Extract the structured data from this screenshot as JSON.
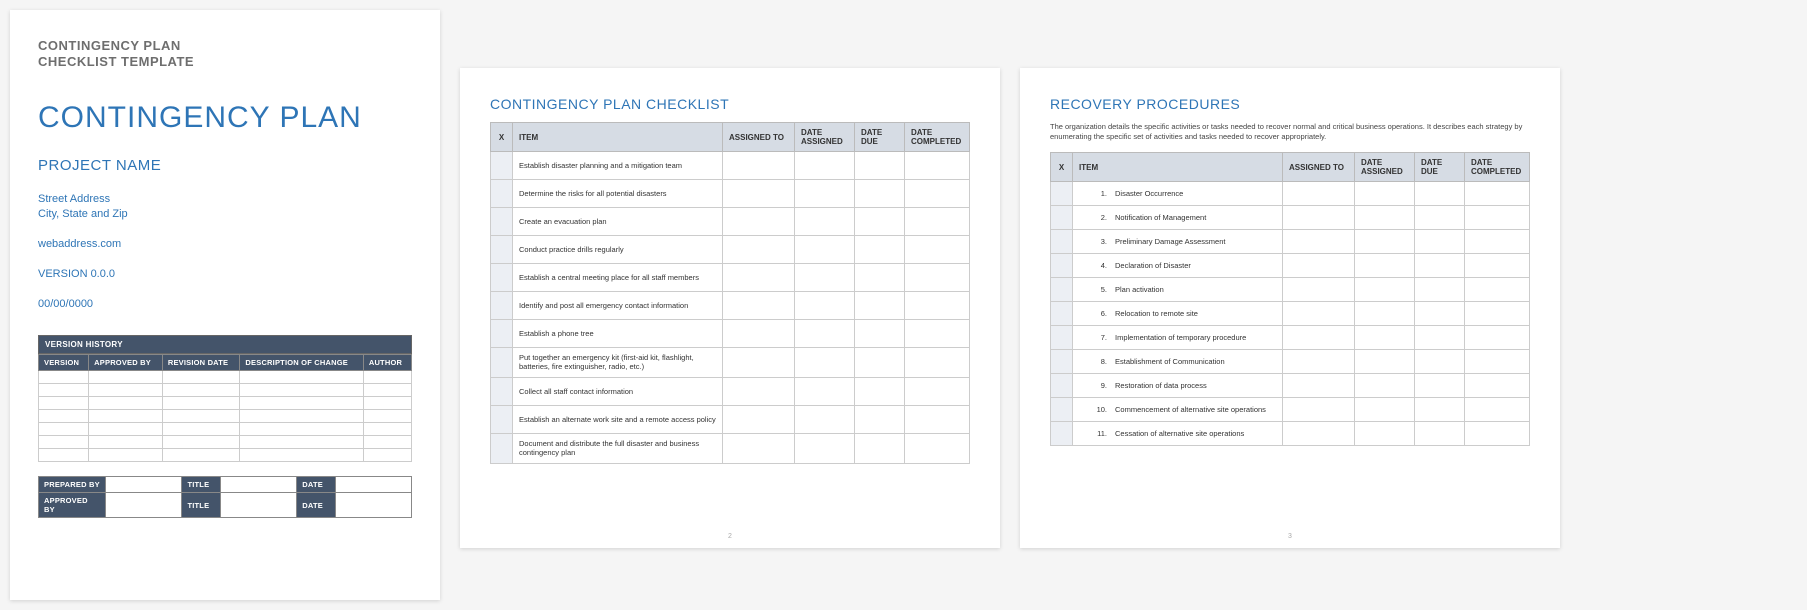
{
  "page1": {
    "label_line1": "CONTINGENCY PLAN",
    "label_line2": "CHECKLIST TEMPLATE",
    "title": "CONTINGENCY PLAN",
    "subtitle": "PROJECT NAME",
    "address_line1": "Street Address",
    "address_line2": "City, State and Zip",
    "web": "webaddress.com",
    "version": "VERSION 0.0.0",
    "date": "00/00/0000",
    "version_history": {
      "header": "VERSION HISTORY",
      "cols": [
        "VERSION",
        "APPROVED BY",
        "REVISION DATE",
        "DESCRIPTION OF CHANGE",
        "AUTHOR"
      ],
      "blank_rows": 7
    },
    "sig": {
      "rows": [
        {
          "label": "PREPARED BY",
          "title": "TITLE",
          "date": "DATE"
        },
        {
          "label": "APPROVED BY",
          "title": "TITLE",
          "date": "DATE"
        }
      ]
    }
  },
  "page2": {
    "title": "CONTINGENCY PLAN CHECKLIST",
    "cols": {
      "x": "X",
      "item": "ITEM",
      "assigned": "ASSIGNED TO",
      "dassigned": "DATE ASSIGNED",
      "ddue": "DATE DUE",
      "dcomp": "DATE COMPLETED"
    },
    "items": [
      "Establish disaster planning and a mitigation team",
      "Determine the risks for all potential disasters",
      "Create an evacuation plan",
      "Conduct practice drills regularly",
      "Establish a central meeting place for all staff members",
      "Identify and post all emergency contact information",
      "Establish a phone tree",
      "Put together an emergency kit (first-aid kit, flashlight, batteries, fire extinguisher, radio, etc.)",
      "Collect all staff contact information",
      "Establish an alternate work site and a remote access policy",
      "Document and distribute the full disaster and business contingency plan"
    ],
    "pagenum": "2"
  },
  "page3": {
    "title": "RECOVERY PROCEDURES",
    "desc": "The organization details the specific activities or tasks needed to recover normal and critical business operations. It describes each strategy by enumerating the specific set of activities and tasks needed to recover appropriately.",
    "cols": {
      "x": "X",
      "item": "ITEM",
      "assigned": "ASSIGNED TO",
      "dassigned": "DATE ASSIGNED",
      "ddue": "DATE DUE",
      "dcomp": "DATE COMPLETED"
    },
    "items": [
      "Disaster Occurrence",
      "Notification of Management",
      "Preliminary Damage Assessment",
      "Declaration of Disaster",
      "Plan activation",
      "Relocation to remote site",
      "Implementation of temporary procedure",
      "Establishment of Communication",
      "Restoration of data process",
      "Commencement of alternative site operations",
      "Cessation of alternative site operations"
    ],
    "pagenum": "3"
  }
}
